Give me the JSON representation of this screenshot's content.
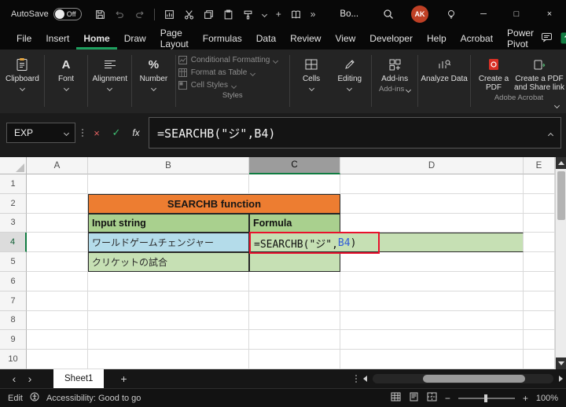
{
  "title_bar": {
    "autosave_label": "AutoSave",
    "autosave_state": "Off",
    "doc_title": "Bo...",
    "avatar_initials": "AK"
  },
  "menu": {
    "items": [
      "File",
      "Insert",
      "Home",
      "Draw",
      "Page Layout",
      "Formulas",
      "Data",
      "Review",
      "View",
      "Developer",
      "Help",
      "Acrobat",
      "Power Pivot"
    ]
  },
  "ribbon": {
    "clipboard": "Clipboard",
    "font": "Font",
    "alignment": "Alignment",
    "number": "Number",
    "styles_items": [
      "Conditional Formatting",
      "Format as Table",
      "Cell Styles"
    ],
    "styles_label": "Styles",
    "cells": "Cells",
    "editing": "Editing",
    "addins": "Add-ins",
    "addins_group": "Add-ins",
    "analyze": "Analyze Data",
    "create_pdf": "Create a PDF",
    "create_pdf_share": "Create a PDF and Share link",
    "acrobat_group": "Adobe Acrobat"
  },
  "formula_bar": {
    "name_box": "EXP",
    "cancel": "×",
    "enter": "✓",
    "fx": "fx",
    "formula": "=SEARCHB(\"ジ\",B4)"
  },
  "grid": {
    "columns": [
      "A",
      "B",
      "C",
      "D",
      "E"
    ],
    "rows": [
      "1",
      "2",
      "3",
      "4",
      "5",
      "6",
      "7",
      "8",
      "9",
      "10"
    ]
  },
  "sheet_content": {
    "title": "SEARCHB function",
    "input_header": "Input string",
    "formula_header": "Formula",
    "input_1": "ワールドゲームチェンジャー",
    "input_2": "クリケットの試合",
    "formula_prefix": "=SEARCHB(\"ジ\",",
    "formula_ref": "B4",
    "formula_suffix": ")"
  },
  "tab_bar": {
    "sheet_name": "Sheet1",
    "prev": "‹",
    "next": "›",
    "add": "+"
  },
  "status_bar": {
    "mode": "Edit",
    "accessibility": "Accessibility: Good to go",
    "zoom_out": "−",
    "zoom_in": "+",
    "zoom_level": "100%"
  },
  "window": {
    "minimize": "─",
    "maximize": "□",
    "close": "×"
  },
  "icons_text": {
    "more": "»",
    "percent": "%",
    "font_a": "A"
  },
  "colors": {
    "accent_green": "#1ea05f",
    "header_orange": "#ed7d31",
    "green_header_fill": "#a9d08e",
    "green_fill": "#c6e0b4",
    "blue_fill": "#b4dcea",
    "highlight_red": "#e8112d",
    "reference_blue": "#2f5bd7"
  }
}
